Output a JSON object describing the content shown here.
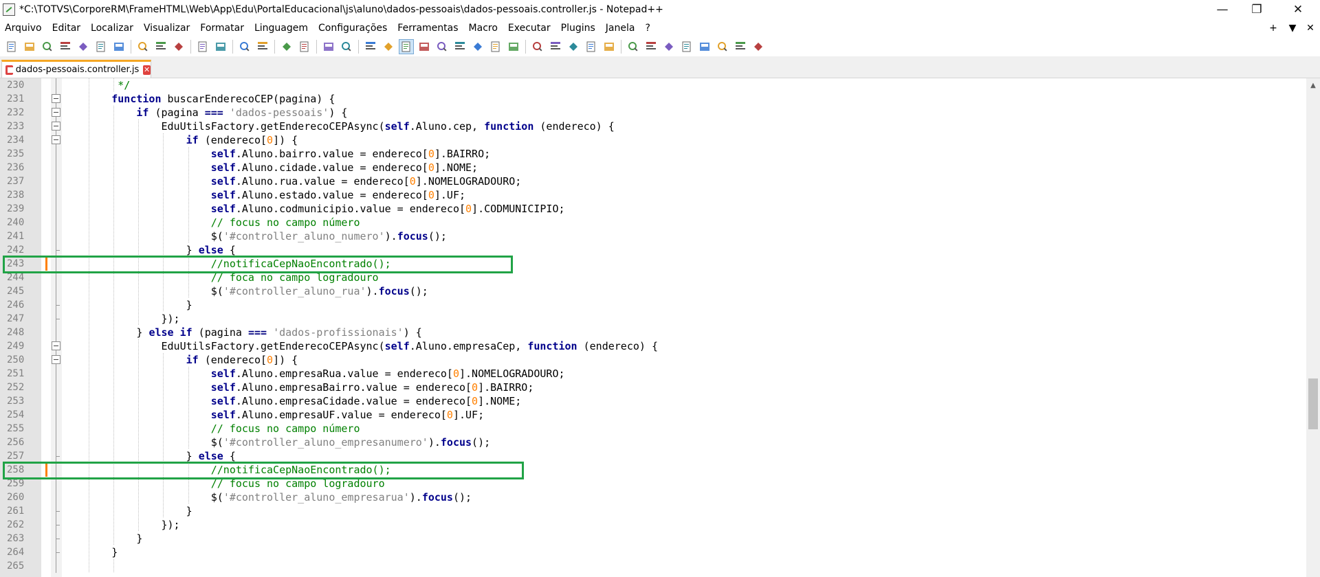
{
  "window": {
    "title": "*C:\\TOTVS\\CorporeRM\\FrameHTML\\Web\\App\\Edu\\PortalEducacional\\js\\aluno\\dados-pessoais\\dados-pessoais.controller.js - Notepad++",
    "minimize": "—",
    "restore": "❐",
    "close": "✕"
  },
  "menu": {
    "items": [
      "Arquivo",
      "Editar",
      "Localizar",
      "Visualizar",
      "Formatar",
      "Linguagem",
      "Configurações",
      "Ferramentas",
      "Macro",
      "Executar",
      "Plugins",
      "Janela",
      "?"
    ],
    "right": [
      "+",
      "▼",
      "✕"
    ]
  },
  "toolbar": {
    "buttons": [
      "new-file-icon",
      "open-file-icon",
      "save-icon",
      "save-all-icon",
      "close-icon",
      "close-all-icon",
      "print-icon",
      "cut-icon",
      "copy-icon",
      "paste-icon",
      "undo-icon",
      "redo-icon",
      "find-icon",
      "replace-icon",
      "zoom-in-icon",
      "zoom-out-icon",
      "sync-vertical-icon",
      "sync-horizontal-icon",
      "word-wrap-icon",
      "show-all-chars-icon",
      "indent-guide-icon",
      "user-lang-icon",
      "doc-map-icon",
      "function-list-icon",
      "folder-workspace-icon",
      "doc-list-icon",
      "monitoring-icon",
      "record-macro-icon",
      "stop-macro-icon",
      "play-macro-icon",
      "run-macro-multiple-icon",
      "save-macro-icon",
      "bookmark-icon",
      "compare-icon",
      "diff-icon",
      "align-icon",
      "move-up-icon",
      "move-down-icon",
      "sort-icon",
      "panel-icon"
    ]
  },
  "tab": {
    "label": "dados-pessoais.controller.js",
    "close": "✕"
  },
  "editor": {
    "lines": [
      {
        "n": "230",
        "t": [
          [
            "",
            "        "
          ],
          [
            "cmt",
            " */"
          ]
        ]
      },
      {
        "n": "231",
        "t": [
          [
            "",
            "        "
          ],
          [
            "kw",
            "function"
          ],
          [
            "",
            " buscarEnderecoCEP(pagina) {"
          ]
        ]
      },
      {
        "n": "232",
        "t": [
          [
            "",
            "            "
          ],
          [
            "kw",
            "if"
          ],
          [
            "",
            " (pagina "
          ],
          [
            "op",
            "==="
          ],
          [
            "",
            " "
          ],
          [
            "str",
            "'dados-pessoais'"
          ],
          [
            "",
            ") {"
          ]
        ]
      },
      {
        "n": "233",
        "t": [
          [
            "",
            "                EduUtilsFactory.getEnderecoCEPAsync("
          ],
          [
            "kw",
            "self"
          ],
          [
            "",
            ".Aluno.cep, "
          ],
          [
            "kw",
            "function"
          ],
          [
            "",
            " (endereco) {"
          ]
        ]
      },
      {
        "n": "234",
        "t": [
          [
            "",
            "                    "
          ],
          [
            "kw",
            "if"
          ],
          [
            "",
            " (endereco["
          ],
          [
            "num",
            "0"
          ],
          [
            "",
            "]) {"
          ]
        ]
      },
      {
        "n": "235",
        "t": [
          [
            "",
            "                        "
          ],
          [
            "kw",
            "self"
          ],
          [
            "",
            ".Aluno.bairro.value = endereco["
          ],
          [
            "num",
            "0"
          ],
          [
            "",
            "].BAIRRO;"
          ]
        ]
      },
      {
        "n": "236",
        "t": [
          [
            "",
            "                        "
          ],
          [
            "kw",
            "self"
          ],
          [
            "",
            ".Aluno.cidade.value = endereco["
          ],
          [
            "num",
            "0"
          ],
          [
            "",
            "].NOME;"
          ]
        ]
      },
      {
        "n": "237",
        "t": [
          [
            "",
            "                        "
          ],
          [
            "kw",
            "self"
          ],
          [
            "",
            ".Aluno.rua.value = endereco["
          ],
          [
            "num",
            "0"
          ],
          [
            "",
            "].NOMELOGRADOURO;"
          ]
        ]
      },
      {
        "n": "238",
        "t": [
          [
            "",
            "                        "
          ],
          [
            "kw",
            "self"
          ],
          [
            "",
            ".Aluno.estado.value = endereco["
          ],
          [
            "num",
            "0"
          ],
          [
            "",
            "].UF;"
          ]
        ]
      },
      {
        "n": "239",
        "t": [
          [
            "",
            "                        "
          ],
          [
            "kw",
            "self"
          ],
          [
            "",
            ".Aluno.codmunicipio.value = endereco["
          ],
          [
            "num",
            "0"
          ],
          [
            "",
            "].CODMUNICIPIO;"
          ]
        ]
      },
      {
        "n": "240",
        "t": [
          [
            "",
            "                        "
          ],
          [
            "cmt",
            "// focus no campo número"
          ]
        ]
      },
      {
        "n": "241",
        "t": [
          [
            "",
            "                        $("
          ],
          [
            "str",
            "'#controller_aluno_numero'"
          ],
          [
            "",
            ")."
          ],
          [
            "kw",
            "focus"
          ],
          [
            "",
            "();"
          ]
        ]
      },
      {
        "n": "242",
        "t": [
          [
            "",
            "                    } "
          ],
          [
            "kw",
            "else"
          ],
          [
            "",
            " {"
          ]
        ]
      },
      {
        "n": "243",
        "t": [
          [
            "",
            "                        "
          ],
          [
            "cmt",
            "//notificaCepNaoEncontrado();"
          ]
        ],
        "changed": true
      },
      {
        "n": "244",
        "t": [
          [
            "",
            "                        "
          ],
          [
            "cmt",
            "// foca no campo logradouro"
          ]
        ]
      },
      {
        "n": "245",
        "t": [
          [
            "",
            "                        $("
          ],
          [
            "str",
            "'#controller_aluno_rua'"
          ],
          [
            "",
            ")."
          ],
          [
            "kw",
            "focus"
          ],
          [
            "",
            "();"
          ]
        ]
      },
      {
        "n": "246",
        "t": [
          [
            "",
            "                    }"
          ]
        ]
      },
      {
        "n": "247",
        "t": [
          [
            "",
            "                });"
          ]
        ]
      },
      {
        "n": "248",
        "t": [
          [
            "",
            "            } "
          ],
          [
            "kw",
            "else if"
          ],
          [
            "",
            " (pagina "
          ],
          [
            "op",
            "==="
          ],
          [
            "",
            " "
          ],
          [
            "str",
            "'dados-profissionais'"
          ],
          [
            "",
            ") {"
          ]
        ]
      },
      {
        "n": "249",
        "t": [
          [
            "",
            "                EduUtilsFactory.getEnderecoCEPAsync("
          ],
          [
            "kw",
            "self"
          ],
          [
            "",
            ".Aluno.empresaCep, "
          ],
          [
            "kw",
            "function"
          ],
          [
            "",
            " (endereco) {"
          ]
        ]
      },
      {
        "n": "250",
        "t": [
          [
            "",
            "                    "
          ],
          [
            "kw",
            "if"
          ],
          [
            "",
            " (endereco["
          ],
          [
            "num",
            "0"
          ],
          [
            "",
            "]) {"
          ]
        ]
      },
      {
        "n": "251",
        "t": [
          [
            "",
            "                        "
          ],
          [
            "kw",
            "self"
          ],
          [
            "",
            ".Aluno.empresaRua.value = endereco["
          ],
          [
            "num",
            "0"
          ],
          [
            "",
            "].NOMELOGRADOURO;"
          ]
        ]
      },
      {
        "n": "252",
        "t": [
          [
            "",
            "                        "
          ],
          [
            "kw",
            "self"
          ],
          [
            "",
            ".Aluno.empresaBairro.value = endereco["
          ],
          [
            "num",
            "0"
          ],
          [
            "",
            "].BAIRRO;"
          ]
        ]
      },
      {
        "n": "253",
        "t": [
          [
            "",
            "                        "
          ],
          [
            "kw",
            "self"
          ],
          [
            "",
            ".Aluno.empresaCidade.value = endereco["
          ],
          [
            "num",
            "0"
          ],
          [
            "",
            "].NOME;"
          ]
        ]
      },
      {
        "n": "254",
        "t": [
          [
            "",
            "                        "
          ],
          [
            "kw",
            "self"
          ],
          [
            "",
            ".Aluno.empresaUF.value = endereco["
          ],
          [
            "num",
            "0"
          ],
          [
            "",
            "].UF;"
          ]
        ]
      },
      {
        "n": "255",
        "t": [
          [
            "",
            "                        "
          ],
          [
            "cmt",
            "// focus no campo número"
          ]
        ]
      },
      {
        "n": "256",
        "t": [
          [
            "",
            "                        $("
          ],
          [
            "str",
            "'#controller_aluno_empresanumero'"
          ],
          [
            "",
            ")."
          ],
          [
            "kw",
            "focus"
          ],
          [
            "",
            "();"
          ]
        ]
      },
      {
        "n": "257",
        "t": [
          [
            "",
            "                    } "
          ],
          [
            "kw",
            "else"
          ],
          [
            "",
            " {"
          ]
        ]
      },
      {
        "n": "258",
        "t": [
          [
            "",
            "                        "
          ],
          [
            "cmt",
            "//notificaCepNaoEncontrado();"
          ]
        ],
        "changed": true
      },
      {
        "n": "259",
        "t": [
          [
            "",
            "                        "
          ],
          [
            "cmt",
            "// focus no campo logradouro"
          ]
        ]
      },
      {
        "n": "260",
        "t": [
          [
            "",
            "                        $("
          ],
          [
            "str",
            "'#controller_aluno_empresarua'"
          ],
          [
            "",
            ")."
          ],
          [
            "kw",
            "focus"
          ],
          [
            "",
            "();"
          ]
        ]
      },
      {
        "n": "261",
        "t": [
          [
            "",
            "                    }"
          ]
        ]
      },
      {
        "n": "262",
        "t": [
          [
            "",
            "                });"
          ]
        ]
      },
      {
        "n": "263",
        "t": [
          [
            "",
            "            }"
          ]
        ]
      },
      {
        "n": "264",
        "t": [
          [
            "",
            "        }"
          ]
        ]
      },
      {
        "n": "265",
        "t": [
          [
            "",
            ""
          ]
        ]
      }
    ],
    "highlight_color": "#21a346",
    "change_marker_color": "#ff8000"
  }
}
